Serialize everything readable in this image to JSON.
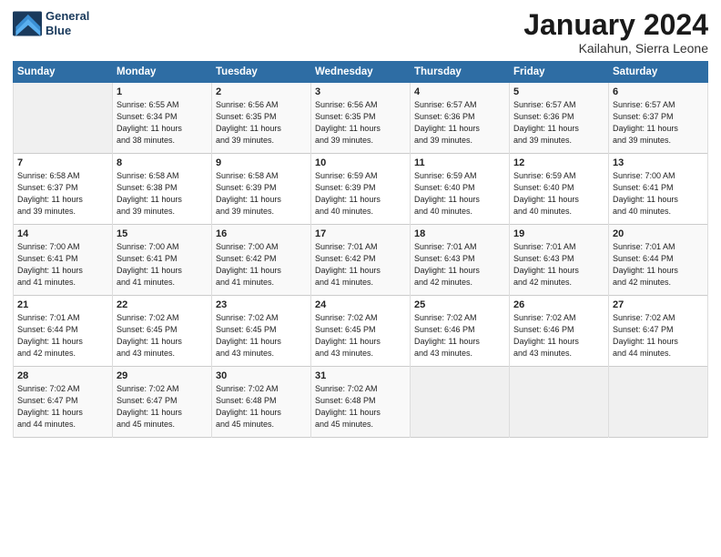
{
  "header": {
    "logo_line1": "General",
    "logo_line2": "Blue",
    "month": "January 2024",
    "location": "Kailahun, Sierra Leone"
  },
  "days_of_week": [
    "Sunday",
    "Monday",
    "Tuesday",
    "Wednesday",
    "Thursday",
    "Friday",
    "Saturday"
  ],
  "weeks": [
    [
      {
        "day": "",
        "sunrise": "",
        "sunset": "",
        "daylight": ""
      },
      {
        "day": "1",
        "sunrise": "Sunrise: 6:55 AM",
        "sunset": "Sunset: 6:34 PM",
        "daylight": "Daylight: 11 hours and 38 minutes."
      },
      {
        "day": "2",
        "sunrise": "Sunrise: 6:56 AM",
        "sunset": "Sunset: 6:35 PM",
        "daylight": "Daylight: 11 hours and 39 minutes."
      },
      {
        "day": "3",
        "sunrise": "Sunrise: 6:56 AM",
        "sunset": "Sunset: 6:35 PM",
        "daylight": "Daylight: 11 hours and 39 minutes."
      },
      {
        "day": "4",
        "sunrise": "Sunrise: 6:57 AM",
        "sunset": "Sunset: 6:36 PM",
        "daylight": "Daylight: 11 hours and 39 minutes."
      },
      {
        "day": "5",
        "sunrise": "Sunrise: 6:57 AM",
        "sunset": "Sunset: 6:36 PM",
        "daylight": "Daylight: 11 hours and 39 minutes."
      },
      {
        "day": "6",
        "sunrise": "Sunrise: 6:57 AM",
        "sunset": "Sunset: 6:37 PM",
        "daylight": "Daylight: 11 hours and 39 minutes."
      }
    ],
    [
      {
        "day": "7",
        "sunrise": "Sunrise: 6:58 AM",
        "sunset": "Sunset: 6:37 PM",
        "daylight": "Daylight: 11 hours and 39 minutes."
      },
      {
        "day": "8",
        "sunrise": "Sunrise: 6:58 AM",
        "sunset": "Sunset: 6:38 PM",
        "daylight": "Daylight: 11 hours and 39 minutes."
      },
      {
        "day": "9",
        "sunrise": "Sunrise: 6:58 AM",
        "sunset": "Sunset: 6:39 PM",
        "daylight": "Daylight: 11 hours and 39 minutes."
      },
      {
        "day": "10",
        "sunrise": "Sunrise: 6:59 AM",
        "sunset": "Sunset: 6:39 PM",
        "daylight": "Daylight: 11 hours and 40 minutes."
      },
      {
        "day": "11",
        "sunrise": "Sunrise: 6:59 AM",
        "sunset": "Sunset: 6:40 PM",
        "daylight": "Daylight: 11 hours and 40 minutes."
      },
      {
        "day": "12",
        "sunrise": "Sunrise: 6:59 AM",
        "sunset": "Sunset: 6:40 PM",
        "daylight": "Daylight: 11 hours and 40 minutes."
      },
      {
        "day": "13",
        "sunrise": "Sunrise: 7:00 AM",
        "sunset": "Sunset: 6:41 PM",
        "daylight": "Daylight: 11 hours and 40 minutes."
      }
    ],
    [
      {
        "day": "14",
        "sunrise": "Sunrise: 7:00 AM",
        "sunset": "Sunset: 6:41 PM",
        "daylight": "Daylight: 11 hours and 41 minutes."
      },
      {
        "day": "15",
        "sunrise": "Sunrise: 7:00 AM",
        "sunset": "Sunset: 6:41 PM",
        "daylight": "Daylight: 11 hours and 41 minutes."
      },
      {
        "day": "16",
        "sunrise": "Sunrise: 7:00 AM",
        "sunset": "Sunset: 6:42 PM",
        "daylight": "Daylight: 11 hours and 41 minutes."
      },
      {
        "day": "17",
        "sunrise": "Sunrise: 7:01 AM",
        "sunset": "Sunset: 6:42 PM",
        "daylight": "Daylight: 11 hours and 41 minutes."
      },
      {
        "day": "18",
        "sunrise": "Sunrise: 7:01 AM",
        "sunset": "Sunset: 6:43 PM",
        "daylight": "Daylight: 11 hours and 42 minutes."
      },
      {
        "day": "19",
        "sunrise": "Sunrise: 7:01 AM",
        "sunset": "Sunset: 6:43 PM",
        "daylight": "Daylight: 11 hours and 42 minutes."
      },
      {
        "day": "20",
        "sunrise": "Sunrise: 7:01 AM",
        "sunset": "Sunset: 6:44 PM",
        "daylight": "Daylight: 11 hours and 42 minutes."
      }
    ],
    [
      {
        "day": "21",
        "sunrise": "Sunrise: 7:01 AM",
        "sunset": "Sunset: 6:44 PM",
        "daylight": "Daylight: 11 hours and 42 minutes."
      },
      {
        "day": "22",
        "sunrise": "Sunrise: 7:02 AM",
        "sunset": "Sunset: 6:45 PM",
        "daylight": "Daylight: 11 hours and 43 minutes."
      },
      {
        "day": "23",
        "sunrise": "Sunrise: 7:02 AM",
        "sunset": "Sunset: 6:45 PM",
        "daylight": "Daylight: 11 hours and 43 minutes."
      },
      {
        "day": "24",
        "sunrise": "Sunrise: 7:02 AM",
        "sunset": "Sunset: 6:45 PM",
        "daylight": "Daylight: 11 hours and 43 minutes."
      },
      {
        "day": "25",
        "sunrise": "Sunrise: 7:02 AM",
        "sunset": "Sunset: 6:46 PM",
        "daylight": "Daylight: 11 hours and 43 minutes."
      },
      {
        "day": "26",
        "sunrise": "Sunrise: 7:02 AM",
        "sunset": "Sunset: 6:46 PM",
        "daylight": "Daylight: 11 hours and 43 minutes."
      },
      {
        "day": "27",
        "sunrise": "Sunrise: 7:02 AM",
        "sunset": "Sunset: 6:47 PM",
        "daylight": "Daylight: 11 hours and 44 minutes."
      }
    ],
    [
      {
        "day": "28",
        "sunrise": "Sunrise: 7:02 AM",
        "sunset": "Sunset: 6:47 PM",
        "daylight": "Daylight: 11 hours and 44 minutes."
      },
      {
        "day": "29",
        "sunrise": "Sunrise: 7:02 AM",
        "sunset": "Sunset: 6:47 PM",
        "daylight": "Daylight: 11 hours and 45 minutes."
      },
      {
        "day": "30",
        "sunrise": "Sunrise: 7:02 AM",
        "sunset": "Sunset: 6:48 PM",
        "daylight": "Daylight: 11 hours and 45 minutes."
      },
      {
        "day": "31",
        "sunrise": "Sunrise: 7:02 AM",
        "sunset": "Sunset: 6:48 PM",
        "daylight": "Daylight: 11 hours and 45 minutes."
      },
      {
        "day": "",
        "sunrise": "",
        "sunset": "",
        "daylight": ""
      },
      {
        "day": "",
        "sunrise": "",
        "sunset": "",
        "daylight": ""
      },
      {
        "day": "",
        "sunrise": "",
        "sunset": "",
        "daylight": ""
      }
    ]
  ]
}
